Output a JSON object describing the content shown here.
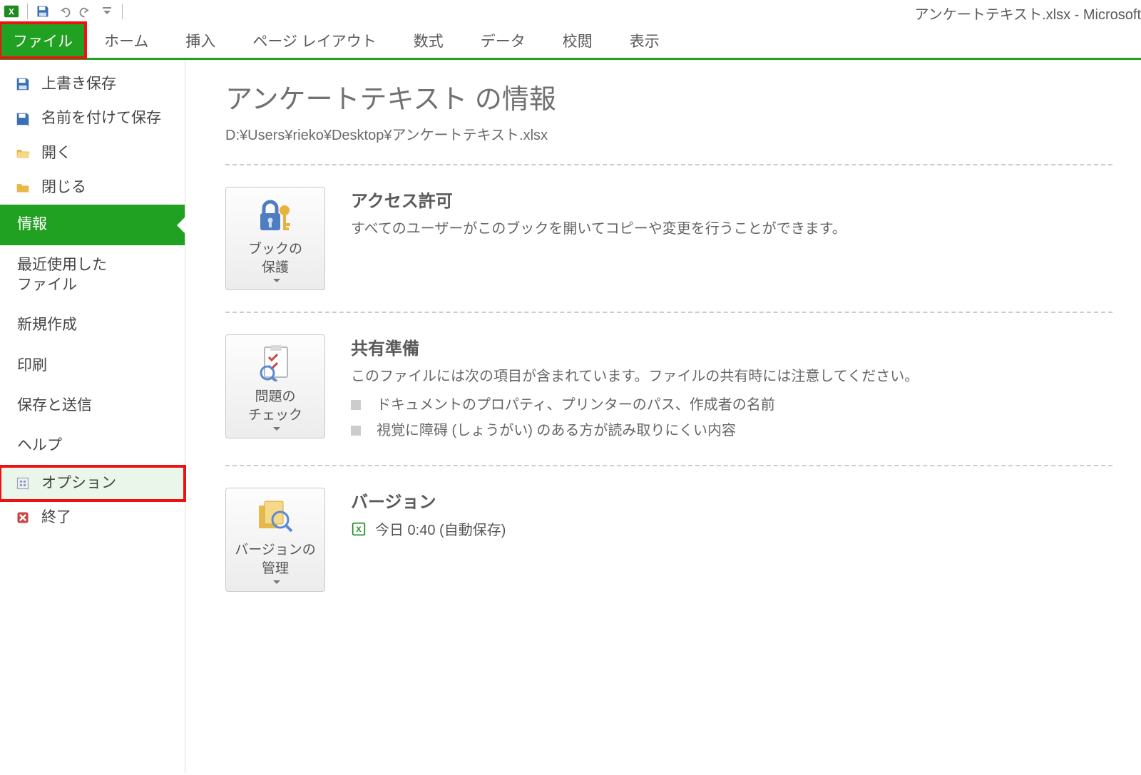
{
  "title_bar": "アンケートテキスト.xlsx - Microsoft",
  "tabs": {
    "file": "ファイル",
    "home": "ホーム",
    "insert": "挿入",
    "pageLayout": "ページ レイアウト",
    "formulas": "数式",
    "data": "データ",
    "review": "校閲",
    "view": "表示"
  },
  "nav": {
    "save": "上書き保存",
    "saveAs": "名前を付けて保存",
    "open": "開く",
    "close": "閉じる",
    "info": "情報",
    "recent": "最近使用した\nファイル",
    "new": "新規作成",
    "print": "印刷",
    "saveSend": "保存と送信",
    "help": "ヘルプ",
    "options": "オプション",
    "exit": "終了"
  },
  "content": {
    "title": "アンケートテキスト の情報",
    "path": "D:¥Users¥rieko¥Desktop¥アンケートテキスト.xlsx",
    "permissions": {
      "button": "ブックの\n保護",
      "heading": "アクセス許可",
      "desc": "すべてのユーザーがこのブックを開いてコピーや変更を行うことができます。"
    },
    "prepare": {
      "button": "問題の\nチェック",
      "heading": "共有準備",
      "desc": "このファイルには次の項目が含まれています。ファイルの共有時には注意してください。",
      "item1": "ドキュメントのプロパティ、プリンターのパス、作成者の名前",
      "item2": "視覚に障碍 (しょうがい) のある方が読み取りにくい内容"
    },
    "versions": {
      "button": "バージョンの\n管理",
      "heading": "バージョン",
      "line": "今日 0:40 (自動保存)"
    }
  }
}
